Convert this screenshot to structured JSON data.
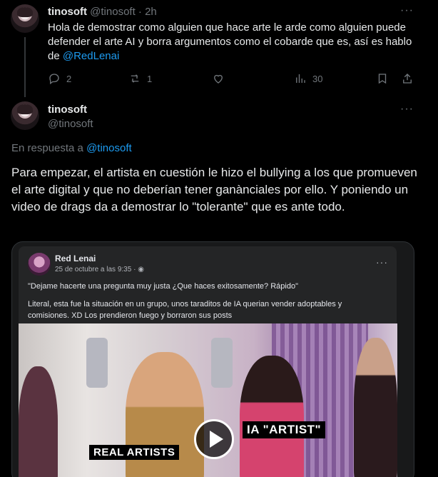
{
  "post1": {
    "display_name": "tinosoft",
    "handle": "@tinosoft",
    "separator": "·",
    "time": "2h",
    "more": "···",
    "text_before": "Hola de demostrar como alguien que hace arte le arde como alguien puede defender el arte AI y borra argumentos como el cobarde que es, así es hablo de ",
    "mention": "@RedLenai",
    "replies": "2",
    "reposts": "1",
    "views": "30"
  },
  "post2": {
    "display_name": "tinosoft",
    "handle": "@tinosoft",
    "more": "···",
    "reply_prefix": "En respuesta a ",
    "reply_mention": "@tinosoft",
    "text": "Para empezar, el artista en cuestión le hizo el bullying a los que promueven el arte digital y que no deberían tener ganànciales por ello. Y poniendo un video de drags da a demostrar lo \"tolerante\" que es ante todo."
  },
  "embedded": {
    "author": "Red Lenai",
    "date": "25 de octubre a las 9:35 ·",
    "more": "···",
    "quote": "\"Dejame hacerte una pregunta muy justa ¿Que haces exitosamente? Rápido\"",
    "body": "Literal, esta fue la situación en un grupo, unos taraditos de IA querian vender adoptables y comisiones. XD Los prendieron fuego y borraron sus posts",
    "video_caption_left": "REAL ARTISTS",
    "video_caption_right": "IA \"ARTIST\""
  },
  "icons": {
    "reply": "reply-icon",
    "repost": "repost-icon",
    "like": "like-icon",
    "views": "views-icon",
    "bookmark": "bookmark-icon",
    "share": "share-icon",
    "play": "play-icon",
    "globe": "globe-icon"
  },
  "colors": {
    "background": "#000000",
    "text": "#e7e9ea",
    "muted": "#71767b",
    "link": "#1d9bf0",
    "fb_card": "#242526"
  }
}
